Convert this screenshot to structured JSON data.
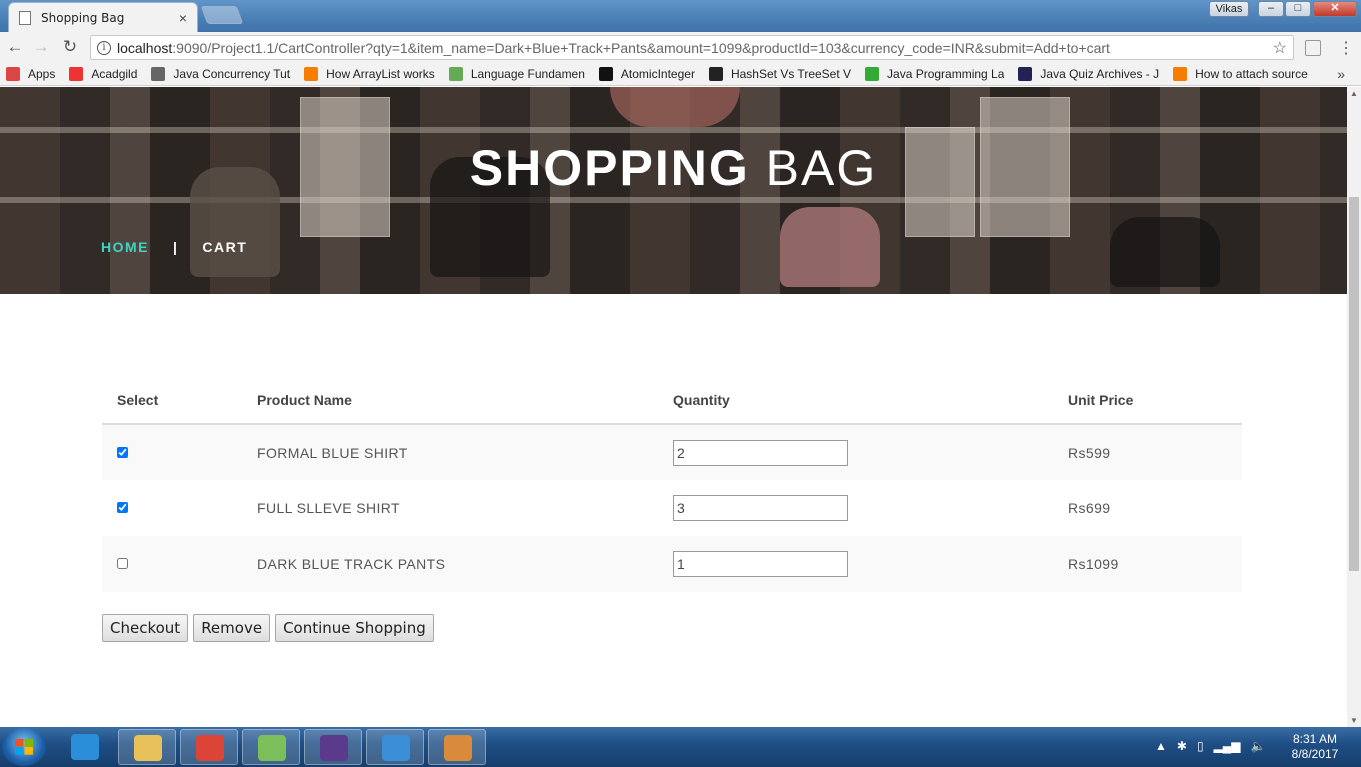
{
  "browser": {
    "tab_title": "Shopping Bag",
    "tab_close": "×",
    "user_name": "Vikas",
    "url_host": "localhost",
    "url_path": ":9090/Project1.1/CartController?qty=1&item_name=Dark+Blue+Track+Pants&amount=1099&productId=103&currency_code=INR&submit=Add+to+cart",
    "bookmarks": [
      {
        "label": "Apps",
        "icon": "apps-grid-icon",
        "color": "#d44"
      },
      {
        "label": "Acadgild",
        "icon": "acadgild-icon",
        "color": "#e33"
      },
      {
        "label": "Java Concurrency Tut",
        "icon": "diamond-icon",
        "color": "#666"
      },
      {
        "label": "How ArrayList works",
        "icon": "blogger-icon",
        "color": "#f57d00"
      },
      {
        "label": "Language Fundamen",
        "icon": "leaf-icon",
        "color": "#6a5"
      },
      {
        "label": "AtomicInteger",
        "icon": "j-icon",
        "color": "#111"
      },
      {
        "label": "HashSet Vs TreeSet V",
        "icon": "terminal-icon",
        "color": "#222"
      },
      {
        "label": "Java Programming La",
        "icon": "pinwheel-icon",
        "color": "#3a3"
      },
      {
        "label": "Java Quiz Archives - J",
        "icon": "quiz-icon",
        "color": "#225"
      },
      {
        "label": "How to attach source",
        "icon": "blogger-icon",
        "color": "#f57d00"
      }
    ],
    "more_bookmarks": "»"
  },
  "hero": {
    "title_bold": "SHOPPING",
    "title_light": "BAG",
    "breadcrumb_home": "HOME",
    "breadcrumb_sep": "|",
    "breadcrumb_current": "CART"
  },
  "cart": {
    "headers": {
      "select": "Select",
      "product_name": "Product Name",
      "quantity": "Quantity",
      "unit_price": "Unit Price"
    },
    "rows": [
      {
        "checked": true,
        "name": "FORMAL BLUE SHIRT",
        "qty": "2",
        "price": "Rs599"
      },
      {
        "checked": true,
        "name": "FULL SLLEVE SHIRT",
        "qty": "3",
        "price": "Rs699"
      },
      {
        "checked": false,
        "name": "DARK BLUE TRACK PANTS",
        "qty": "1",
        "price": "Rs1099"
      }
    ],
    "buttons": {
      "checkout": "Checkout",
      "remove": "Remove",
      "continue": "Continue Shopping"
    }
  },
  "taskbar": {
    "apps": [
      {
        "icon": "ie-icon",
        "color": "#2a8fd8"
      },
      {
        "icon": "folder-icon",
        "color": "#e8c15a"
      },
      {
        "icon": "chrome-icon",
        "color": "#db4437"
      },
      {
        "icon": "notepad-icon",
        "color": "#7bbf5a"
      },
      {
        "icon": "java-ee-ide-icon",
        "color": "#5b3a8c"
      },
      {
        "icon": "media-player-icon",
        "color": "#3b8fd6"
      },
      {
        "icon": "paint-icon",
        "color": "#d98a3a"
      }
    ],
    "time": "8:31 AM",
    "date": "8/8/2017"
  }
}
